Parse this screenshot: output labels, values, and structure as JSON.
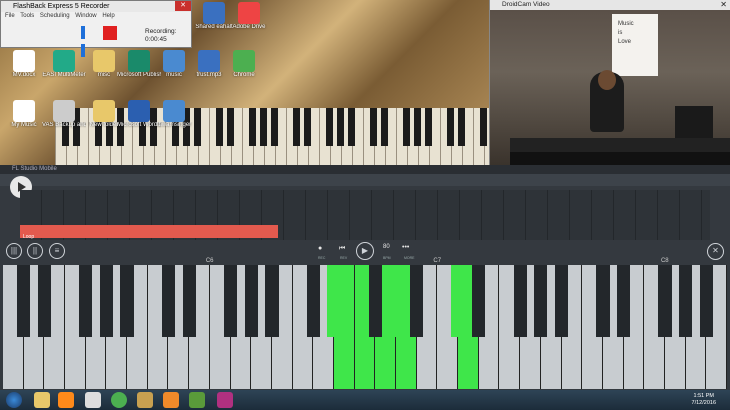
{
  "flashback": {
    "title": "FlashBack Express 5 Recorder",
    "menu": [
      "File",
      "Tools",
      "Scheduling",
      "Window",
      "Help"
    ],
    "recording_label": "Recording:",
    "recording_time": "0:00:45"
  },
  "desktop": {
    "icons": [
      {
        "label": "Finamax",
        "color": "#ffffff"
      },
      {
        "label": "Ubcmine2",
        "color": "#dd4444"
      },
      {
        "label": "Te tie lowercuse",
        "color": "#3a70c0"
      },
      {
        "label": "Shared eahalt",
        "color": "#3a70c0"
      },
      {
        "label": "Adobe Drive",
        "color": "#e44"
      },
      {
        "label": "MV.docx",
        "color": "#fff"
      },
      {
        "label": "EASI MultiMeter",
        "color": "#2a8"
      },
      {
        "label": "misc",
        "color": "#e8c86a"
      },
      {
        "label": "Microsoft Publish",
        "color": "#1a8a6a"
      },
      {
        "label": "music",
        "color": "#4a8ad0"
      },
      {
        "label": "trust.mp3",
        "color": "#3a70c0"
      },
      {
        "label": "Chrome",
        "color": "#4caf50"
      },
      {
        "label": "My Music",
        "color": "#fff"
      },
      {
        "label": "VAS Backup and Restore",
        "color": "#ccc"
      },
      {
        "label": "New folder",
        "color": "#e8c86a"
      },
      {
        "label": "Microsoft Word 2010",
        "color": "#2b5fb0"
      },
      {
        "label": "thwarnsinger",
        "color": "#4a8ad0"
      }
    ]
  },
  "droidcam": {
    "title": "DroidCam Video",
    "poster_lines": [
      "Music",
      "is",
      "Love"
    ]
  },
  "fl": {
    "title": "FL Studio Mobile",
    "clip_label": "Loop",
    "controls": {
      "bpm": "80",
      "labels": [
        "REC",
        "REV",
        "PLAY",
        "BPM",
        "MORE"
      ]
    },
    "octaves": [
      "C6",
      "C7",
      "C8"
    ]
  },
  "taskbar": {
    "time": "1:51 PM",
    "date": "7/12/2016"
  },
  "colors": {
    "active_key": "#3fe64a",
    "clip": "#e35a4e"
  }
}
